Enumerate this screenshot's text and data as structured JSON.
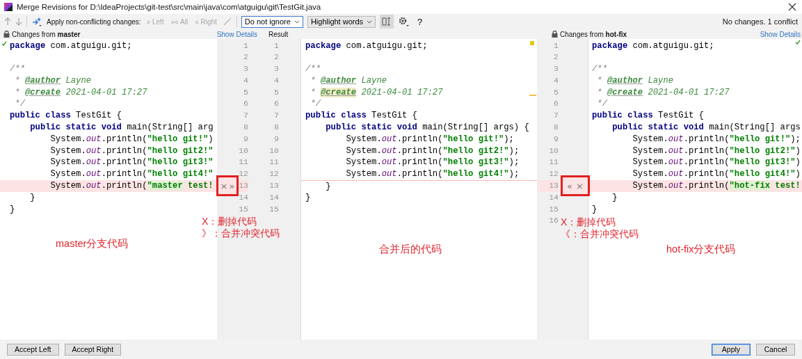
{
  "window": {
    "title": "Merge Revisions for D:\\IdeaProjects\\git-test\\src\\main\\java\\com\\atguigu\\git\\TestGit.java"
  },
  "toolbar": {
    "apply_label": "Apply non-conflicting changes:",
    "apply_actions": [
      {
        "glyph": "»",
        "label": "Left",
        "disabled": true
      },
      {
        "glyph": "»«",
        "label": "All",
        "disabled": true
      },
      {
        "glyph": "«",
        "label": "Right",
        "disabled": true
      }
    ],
    "ignore_select": "Do not ignore",
    "highlight_select": "Highlight words",
    "help": "?",
    "status": "No changes. 1 conflict"
  },
  "left": {
    "header": "Changes from **master**",
    "show_details": "Show Details",
    "note": "master分支代码",
    "lines": [
      {
        "kind": "plain",
        "tokens": [
          {
            "kind": "kw",
            "text": "package"
          },
          {
            "kind": "p",
            "text": " com.atguigu.git;"
          }
        ]
      },
      {
        "kind": "plain"
      },
      {
        "kind": "plain",
        "tokens": [
          {
            "kind": "cmt",
            "text": "/**"
          }
        ]
      },
      {
        "kind": "plain",
        "tokens": [
          {
            "kind": "cmt",
            "text": " * "
          },
          {
            "kind": "tag",
            "text": "@author"
          },
          {
            "kind": "doc",
            "text": " Layne"
          }
        ]
      },
      {
        "kind": "plain",
        "tokens": [
          {
            "kind": "cmt",
            "text": " * "
          },
          {
            "kind": "tag",
            "text": "@create"
          },
          {
            "kind": "doc",
            "text": " 2021-04-01 17:27"
          }
        ]
      },
      {
        "kind": "plain",
        "tokens": [
          {
            "kind": "cmt",
            "text": " */"
          }
        ]
      },
      {
        "kind": "plain",
        "tokens": [
          {
            "kind": "kw",
            "text": "public class"
          },
          {
            "kind": "p",
            "text": " TestGit {"
          }
        ]
      },
      {
        "kind": "plain",
        "tokens": [
          {
            "kind": "kw",
            "text": "    public static void"
          },
          {
            "kind": "p",
            "text": " main(String[] arg"
          }
        ]
      },
      {
        "kind": "plain",
        "tokens": [
          {
            "kind": "p",
            "text": "        System."
          },
          {
            "kind": "field",
            "text": "out"
          },
          {
            "kind": "p",
            "text": ".println("
          },
          {
            "kind": "str",
            "text": "\"hello git!\""
          },
          {
            "kind": "p",
            "text": ")"
          }
        ]
      },
      {
        "kind": "plain",
        "tokens": [
          {
            "kind": "p",
            "text": "        System."
          },
          {
            "kind": "field",
            "text": "out"
          },
          {
            "kind": "p",
            "text": ".println("
          },
          {
            "kind": "str",
            "text": "\"hello git2!\""
          }
        ]
      },
      {
        "kind": "plain",
        "tokens": [
          {
            "kind": "p",
            "text": "        System."
          },
          {
            "kind": "field",
            "text": "out"
          },
          {
            "kind": "p",
            "text": ".println("
          },
          {
            "kind": "str",
            "text": "\"hello git3!\""
          }
        ]
      },
      {
        "kind": "plain",
        "tokens": [
          {
            "kind": "p",
            "text": "        System."
          },
          {
            "kind": "field",
            "text": "out"
          },
          {
            "kind": "p",
            "text": ".println("
          },
          {
            "kind": "str",
            "text": "\"hello git4!\""
          }
        ]
      },
      {
        "kind": "conflict",
        "tokens": [
          {
            "kind": "p",
            "text": "        System."
          },
          {
            "kind": "field",
            "text": "out"
          },
          {
            "kind": "p",
            "text": ".println("
          },
          {
            "kind": "strc",
            "text": "\"master"
          },
          {
            "kind": "str",
            "text": " test!"
          }
        ]
      },
      {
        "kind": "plain",
        "tokens": [
          {
            "kind": "p",
            "text": "    }"
          }
        ]
      },
      {
        "kind": "plain",
        "tokens": [
          {
            "kind": "p",
            "text": "}"
          }
        ]
      }
    ]
  },
  "result": {
    "header": "Result",
    "note": "合并后的代码",
    "lines": [
      {
        "kind": "plain",
        "tokens": [
          {
            "kind": "kw",
            "text": "package"
          },
          {
            "kind": "p",
            "text": " com.atguigu.git;"
          }
        ]
      },
      {
        "kind": "plain"
      },
      {
        "kind": "plain",
        "tokens": [
          {
            "kind": "cmt",
            "text": "/**"
          }
        ]
      },
      {
        "kind": "plain",
        "tokens": [
          {
            "kind": "cmt",
            "text": " * "
          },
          {
            "kind": "tag",
            "text": "@author"
          },
          {
            "kind": "doc",
            "text": " Layne"
          }
        ]
      },
      {
        "kind": "plain",
        "tokens": [
          {
            "kind": "cmt",
            "text": " * "
          },
          {
            "kind": "tagc",
            "text": "@create"
          },
          {
            "kind": "doc",
            "text": " 2021-04-01 17:27"
          }
        ]
      },
      {
        "kind": "plain",
        "tokens": [
          {
            "kind": "cmt",
            "text": " */"
          }
        ]
      },
      {
        "kind": "plain",
        "tokens": [
          {
            "kind": "kw",
            "text": "public class"
          },
          {
            "kind": "p",
            "text": " TestGit {"
          }
        ]
      },
      {
        "kind": "plain",
        "tokens": [
          {
            "kind": "kw",
            "text": "    public static void"
          },
          {
            "kind": "p",
            "text": " main(String[] args) {"
          }
        ]
      },
      {
        "kind": "plain",
        "tokens": [
          {
            "kind": "p",
            "text": "        System."
          },
          {
            "kind": "field",
            "text": "out"
          },
          {
            "kind": "p",
            "text": ".println("
          },
          {
            "kind": "str",
            "text": "\"hello git!\""
          },
          {
            "kind": "p",
            "text": ");"
          }
        ]
      },
      {
        "kind": "plain",
        "tokens": [
          {
            "kind": "p",
            "text": "        System."
          },
          {
            "kind": "field",
            "text": "out"
          },
          {
            "kind": "p",
            "text": ".println("
          },
          {
            "kind": "str",
            "text": "\"hello git2!\""
          },
          {
            "kind": "p",
            "text": ");"
          }
        ]
      },
      {
        "kind": "plain",
        "tokens": [
          {
            "kind": "p",
            "text": "        System."
          },
          {
            "kind": "field",
            "text": "out"
          },
          {
            "kind": "p",
            "text": ".println("
          },
          {
            "kind": "str",
            "text": "\"hello git3!\""
          },
          {
            "kind": "p",
            "text": ");"
          }
        ]
      },
      {
        "kind": "plain",
        "tokens": [
          {
            "kind": "p",
            "text": "        System."
          },
          {
            "kind": "field",
            "text": "out"
          },
          {
            "kind": "p",
            "text": ".println("
          },
          {
            "kind": "str",
            "text": "\"hello git4!\""
          },
          {
            "kind": "p",
            "text": ");"
          }
        ]
      },
      {
        "kind": "gap-above",
        "tokens": [
          {
            "kind": "p",
            "text": "    }"
          }
        ]
      },
      {
        "kind": "plain",
        "tokens": [
          {
            "kind": "p",
            "text": "}"
          }
        ]
      }
    ]
  },
  "right": {
    "header": "Changes from **hot-fix**",
    "show_details": "Show Details",
    "note": "hot-fix分支代码",
    "lines": [
      {
        "kind": "plain",
        "tokens": [
          {
            "kind": "kw",
            "text": "package"
          },
          {
            "kind": "p",
            "text": " com.atguigu.git;"
          }
        ]
      },
      {
        "kind": "plain"
      },
      {
        "kind": "plain",
        "tokens": [
          {
            "kind": "cmt",
            "text": "/**"
          }
        ]
      },
      {
        "kind": "plain",
        "tokens": [
          {
            "kind": "cmt",
            "text": " * "
          },
          {
            "kind": "tag",
            "text": "@author"
          },
          {
            "kind": "doc",
            "text": " Layne"
          }
        ]
      },
      {
        "kind": "plain",
        "tokens": [
          {
            "kind": "cmt",
            "text": " * "
          },
          {
            "kind": "tag",
            "text": "@create"
          },
          {
            "kind": "doc",
            "text": " 2021-04-01 17:27"
          }
        ]
      },
      {
        "kind": "plain",
        "tokens": [
          {
            "kind": "cmt",
            "text": " */"
          }
        ]
      },
      {
        "kind": "plain",
        "tokens": [
          {
            "kind": "kw",
            "text": "public class"
          },
          {
            "kind": "p",
            "text": " TestGit {"
          }
        ]
      },
      {
        "kind": "plain",
        "tokens": [
          {
            "kind": "kw",
            "text": "    public static void"
          },
          {
            "kind": "p",
            "text": " main(String[] args"
          }
        ]
      },
      {
        "kind": "plain",
        "tokens": [
          {
            "kind": "p",
            "text": "        System."
          },
          {
            "kind": "field",
            "text": "out"
          },
          {
            "kind": "p",
            "text": ".println("
          },
          {
            "kind": "str",
            "text": "\"hello git!\""
          },
          {
            "kind": "p",
            "text": ");"
          }
        ]
      },
      {
        "kind": "plain",
        "tokens": [
          {
            "kind": "p",
            "text": "        System."
          },
          {
            "kind": "field",
            "text": "out"
          },
          {
            "kind": "p",
            "text": ".println("
          },
          {
            "kind": "str",
            "text": "\"hello git2!\""
          },
          {
            "kind": "p",
            "text": ")"
          }
        ]
      },
      {
        "kind": "plain",
        "tokens": [
          {
            "kind": "p",
            "text": "        System."
          },
          {
            "kind": "field",
            "text": "out"
          },
          {
            "kind": "p",
            "text": ".println("
          },
          {
            "kind": "str",
            "text": "\"hello git3!\""
          },
          {
            "kind": "p",
            "text": ")"
          }
        ]
      },
      {
        "kind": "plain",
        "tokens": [
          {
            "kind": "p",
            "text": "        System."
          },
          {
            "kind": "field",
            "text": "out"
          },
          {
            "kind": "p",
            "text": ".println("
          },
          {
            "kind": "str",
            "text": "\"hello git4!\""
          },
          {
            "kind": "p",
            "text": ")"
          }
        ]
      },
      {
        "kind": "conflict",
        "tokens": [
          {
            "kind": "p",
            "text": "        System."
          },
          {
            "kind": "field",
            "text": "out"
          },
          {
            "kind": "p",
            "text": ".println("
          },
          {
            "kind": "strc",
            "text": "\"hot-fix"
          },
          {
            "kind": "str",
            "text": " test!"
          }
        ]
      },
      {
        "kind": "plain",
        "tokens": [
          {
            "kind": "p",
            "text": "    }"
          }
        ]
      },
      {
        "kind": "plain",
        "tokens": [
          {
            "kind": "p",
            "text": "}"
          }
        ]
      }
    ]
  },
  "left_gutter": {
    "left_numbers": [
      "1",
      "2",
      "3",
      "4",
      "5",
      "6",
      "7",
      "8",
      "9",
      "10",
      "11",
      "12",
      "13",
      "14",
      "15"
    ],
    "result_numbers": [
      "1",
      "2",
      "3",
      "4",
      "5",
      "6",
      "7",
      "8",
      "9",
      "10",
      "11",
      "12",
      "13",
      "14",
      "15"
    ],
    "actions": [
      "×",
      "»"
    ],
    "notes": [
      "X：删掉代码",
      "》：合并冲突代码"
    ]
  },
  "right_gutter": {
    "numbers": [
      "1",
      "2",
      "3",
      "4",
      "5",
      "6",
      "7",
      "8",
      "9",
      "10",
      "11",
      "12",
      "13",
      "14",
      "15",
      "16"
    ],
    "actions": [
      "«",
      "×"
    ],
    "notes": [
      "X：删掉代码",
      "《：合并冲突代码"
    ]
  },
  "footer": {
    "left_buttons": [
      {
        "label": "Accept Left"
      },
      {
        "label": "Accept Right"
      }
    ],
    "right_buttons": [
      {
        "label": "Apply",
        "default": true
      },
      {
        "label": "Cancel",
        "default": false
      }
    ]
  }
}
